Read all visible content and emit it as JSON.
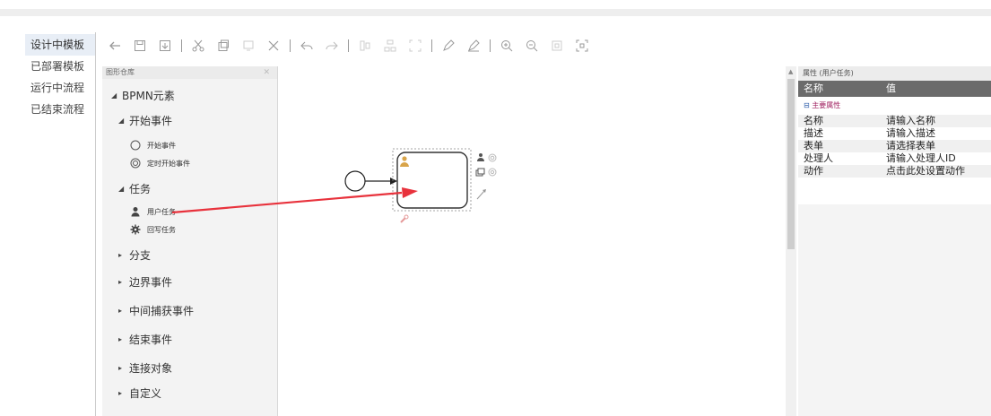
{
  "nav": {
    "items": [
      {
        "label": "设计中模板",
        "active": true
      },
      {
        "label": "已部署模板",
        "active": false
      },
      {
        "label": "运行中流程",
        "active": false
      },
      {
        "label": "已结束流程",
        "active": false
      }
    ]
  },
  "toolbar": {
    "icons": [
      "back-icon",
      "save-icon",
      "import-icon",
      "cut-icon",
      "copy-icon",
      "paste-icon",
      "delete-icon",
      "undo-icon",
      "redo-icon",
      "align-icon",
      "group-icon",
      "fit-icon",
      "edit-icon",
      "edit2-icon",
      "zoom-in-icon",
      "zoom-out-icon",
      "zoom-actual-icon",
      "zoom-fit-icon"
    ]
  },
  "palette": {
    "title": "图形仓库",
    "root": "BPMN元素",
    "groups": [
      {
        "label": "开始事件",
        "expanded": true,
        "items": [
          {
            "label": "开始事件",
            "icon": "circle-icon"
          },
          {
            "label": "定时开始事件",
            "icon": "timer-icon"
          }
        ]
      },
      {
        "label": "任务",
        "expanded": true,
        "items": [
          {
            "label": "用户任务",
            "icon": "user-icon"
          },
          {
            "label": "回写任务",
            "icon": "gear-icon"
          }
        ]
      },
      {
        "label": "分支",
        "expanded": false,
        "items": []
      },
      {
        "label": "边界事件",
        "expanded": false,
        "items": []
      },
      {
        "label": "中间捕获事件",
        "expanded": false,
        "items": []
      },
      {
        "label": "结束事件",
        "expanded": false,
        "items": []
      },
      {
        "label": "连接对象",
        "expanded": false,
        "items": []
      },
      {
        "label": "自定义",
        "expanded": false,
        "items": []
      }
    ]
  },
  "properties": {
    "title": "属性 (用户任务)",
    "col_name": "名称",
    "col_value": "值",
    "group": "主要属性",
    "rows": [
      {
        "key": "名称",
        "value": "请输入名称"
      },
      {
        "key": "描述",
        "value": "请输入描述"
      },
      {
        "key": "表单",
        "value": "请选择表单"
      },
      {
        "key": "处理人",
        "value": "请输入处理人ID"
      },
      {
        "key": "动作",
        "value": "点击此处设置动作"
      }
    ]
  },
  "colors": {
    "arrow": "#e8323c",
    "props_header": "#6b6b6b",
    "group_text": "#a02060"
  }
}
